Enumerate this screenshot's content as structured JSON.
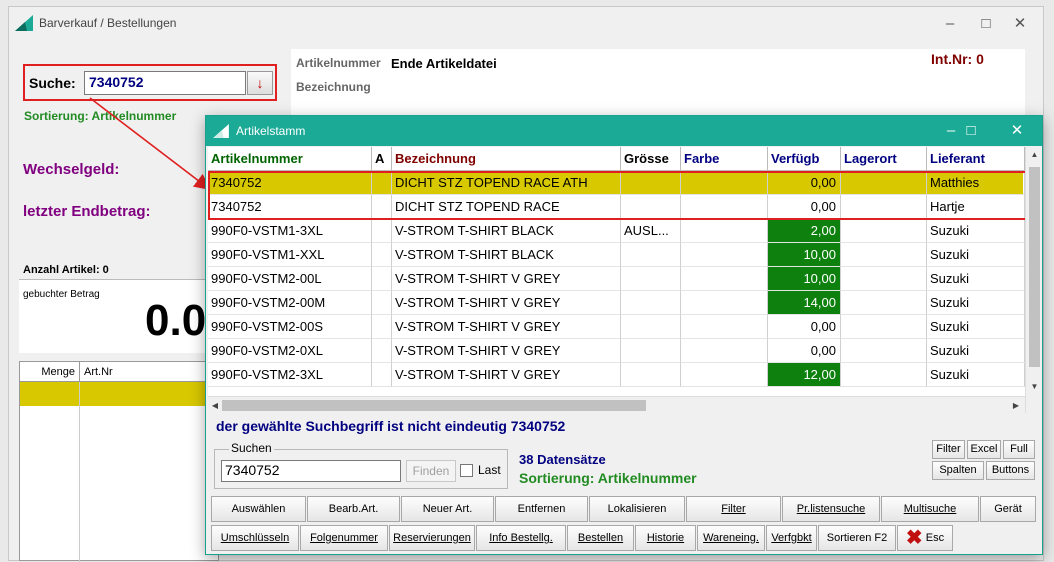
{
  "main_window": {
    "title": "Barverkauf / Bestellungen",
    "search_label": "Suche:",
    "search_value": "7340752",
    "sort_label": "Sortierung: Artikelnummer",
    "wechselgeld_label": "Wechselgeld:",
    "endbetrag_label": "letzter Endbetrag:",
    "anzahl_label": "Anzahl Artikel: 0",
    "gebuchter_label": "gebuchter Betrag",
    "gebuchter_value": "0.0",
    "grid_headers": [
      "Menge",
      "Art.Nr"
    ],
    "artikelnummer_label": "Artikelnummer",
    "artikelnummer_value": "Ende Artikeldatei",
    "bezeichnung_label": "Bezeichnung",
    "intnr": "Int.Nr: 0"
  },
  "dialog": {
    "title": "Artikelstamm",
    "columns": [
      "Artikelnummer",
      "A",
      "Bezeichnung",
      "Grösse",
      "Farbe",
      "Verfügb",
      "Lagerort",
      "Lieferant"
    ],
    "rows": [
      {
        "artnr": "7340752",
        "a": "",
        "bez": "DICHT STZ TOPEND RACE ATH",
        "groesse": "",
        "farbe": "",
        "verf": "0,00",
        "lagerort": "",
        "lieferant": "Matthies",
        "highlight": true,
        "green": false
      },
      {
        "artnr": "7340752",
        "a": "",
        "bez": "DICHT STZ TOPEND RACE",
        "groesse": "",
        "farbe": "",
        "verf": "0,00",
        "lagerort": "",
        "lieferant": "Hartje",
        "highlight": false,
        "green": false
      },
      {
        "artnr": "990F0-VSTM1-3XL",
        "a": "",
        "bez": "V-STROM T-SHIRT BLACK",
        "groesse": "AUSL...",
        "farbe": "",
        "verf": "2,00",
        "lagerort": "",
        "lieferant": "Suzuki",
        "highlight": false,
        "green": true
      },
      {
        "artnr": "990F0-VSTM1-XXL",
        "a": "",
        "bez": "V-STROM T-SHIRT BLACK",
        "groesse": "",
        "farbe": "",
        "verf": "10,00",
        "lagerort": "",
        "lieferant": "Suzuki",
        "highlight": false,
        "green": true
      },
      {
        "artnr": "990F0-VSTM2-00L",
        "a": "",
        "bez": "V-STROM T-SHIRT V GREY",
        "groesse": "",
        "farbe": "",
        "verf": "10,00",
        "lagerort": "",
        "lieferant": "Suzuki",
        "highlight": false,
        "green": true
      },
      {
        "artnr": "990F0-VSTM2-00M",
        "a": "",
        "bez": "V-STROM T-SHIRT V GREY",
        "groesse": "",
        "farbe": "",
        "verf": "14,00",
        "lagerort": "",
        "lieferant": "Suzuki",
        "highlight": false,
        "green": true
      },
      {
        "artnr": "990F0-VSTM2-00S",
        "a": "",
        "bez": "V-STROM T-SHIRT V GREY",
        "groesse": "",
        "farbe": "",
        "verf": "0,00",
        "lagerort": "",
        "lieferant": "Suzuki",
        "highlight": false,
        "green": false
      },
      {
        "artnr": "990F0-VSTM2-0XL",
        "a": "",
        "bez": "V-STROM T-SHIRT V GREY",
        "groesse": "",
        "farbe": "",
        "verf": "0,00",
        "lagerort": "",
        "lieferant": "Suzuki",
        "highlight": false,
        "green": false
      },
      {
        "artnr": "990F0-VSTM2-3XL",
        "a": "",
        "bez": "V-STROM T-SHIRT V GREY",
        "groesse": "",
        "farbe": "",
        "verf": "12,00",
        "lagerort": "",
        "lieferant": "Suzuki",
        "highlight": false,
        "green": true
      }
    ],
    "message": "der gewählte Suchbegriff ist nicht eindeutig 7340752",
    "suchen_legend": "Suchen",
    "suchen_value": "7340752",
    "finden_label": "Finden",
    "last_label": "Last",
    "datensaetze": "38 Datensätze",
    "sortierung": "Sortierung: Artikelnummer",
    "small_buttons": [
      "Filter",
      "Excel",
      "Full",
      "Spalten",
      "Buttons"
    ],
    "buttons_row1": [
      "Auswählen",
      "Bearb.Art.",
      "Neuer Art.",
      "Entfernen",
      "Lokalisieren",
      "Filter",
      "Pr.listensuche",
      "Multisuche",
      "Gerät"
    ],
    "buttons_row2": [
      "Umschlüsseln",
      "Folgenummer",
      "Reservierungen",
      "Info Bestellg.",
      "Bestellen",
      "Historie",
      "Wareneing.",
      "Verfgbkt",
      "Sortieren F2",
      "Esc"
    ]
  },
  "colors": {
    "accent": "#1aaa96",
    "highlight_row": "#d8c800",
    "stock_green": "#0d800d",
    "annotation_red": "#e02020",
    "purple_label": "#800080",
    "navy_text": "#000080"
  },
  "icons": [
    "app-logo-icon",
    "minimize-icon",
    "maximize-icon",
    "close-icon",
    "dropdown-arrow-icon",
    "esc-x-icon"
  ]
}
